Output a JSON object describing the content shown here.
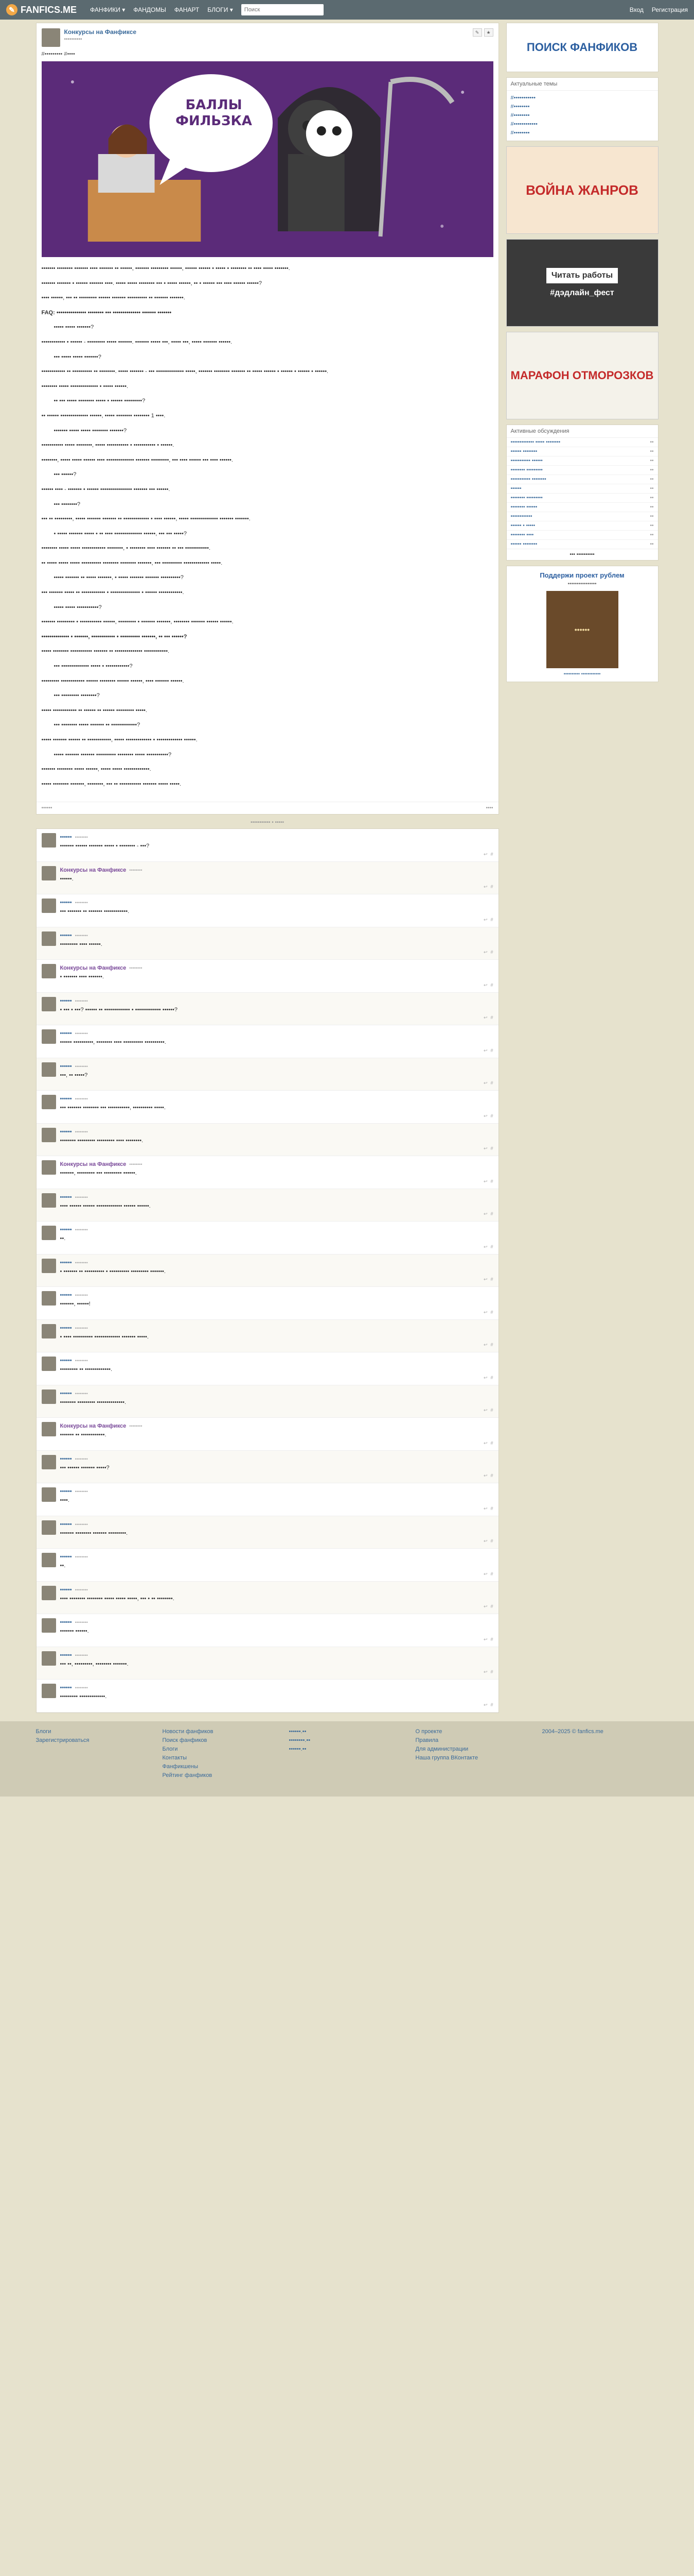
{
  "header": {
    "logo": "FANFICS.ME",
    "nav": [
      "ФАНФИКИ ▾",
      "ФАНДОМЫ",
      "ФАНАРТ",
      "БЛОГИ ▾"
    ],
    "search_placeholder": "Поиск",
    "login": "Вход",
    "register": "Регистрация"
  },
  "post": {
    "author": "Конкурсы на Фанфиксе",
    "date": "••••••••••",
    "tags": "#••••••••• #••••",
    "image_title": "БАЛЛЫ\nФИЛЬЗКА",
    "paragraphs": [
      {
        "t": "••••••• •••••••• ••••••• •••• ••••••• •• ••••••, ••••••• ••••••••• ••••••, •••••• •••••• • ••••• • •••••••• •• •••• ••••• •••••••.",
        "c": ""
      },
      {
        "t": "••••••• ••••••• • •••••• ••••••• ••••. ••••• ••••• •••••••• ••• • ••••• ••••••, •• • •••••• ••• •••• •••••• ••••••?",
        "c": ""
      },
      {
        "t": "•••• ••••••, ••• •• ••••••••• •••••• ••••••• •••••••••• •• ••••••• •••••••.",
        "c": ""
      },
      {
        "t": "FAQ: ••••••••••••••• •••••••• ••• •••••••••••••• ••••••• •••••••",
        "c": "b"
      },
      {
        "t": "••••• ••••• •••••••?",
        "c": "ind"
      },
      {
        "t": "•••••••••••• • •••••• - ••••••••• ••••• •••••••. ••••••• ••••• •••, ••••• •••, ••••• ••••••• ••••••.",
        "c": ""
      },
      {
        "t": "••• ••••• ••••• •••••••?",
        "c": "ind"
      },
      {
        "t": "•••••••••••• •• •••••••••• •• ••••••••. ••••• ••••••• - ••• •••••••••••••• •••••, ••••••• •••••••• ••••••• •• ••••• •••••• • •••••• • •••••• • ••••••.",
        "c": ""
      },
      {
        "t": "•••••••• ••••• •••••••••••••• • ••••• ••••••.",
        "c": ""
      },
      {
        "t": "•• ••• ••••• •••••••• ••••• • •••••• •••••••••?",
        "c": "ind"
      },
      {
        "t": "•• •••••• •••••••••••••• ••••••, ••••• •••••••• •••••••• 1 ••••.",
        "c": ""
      },
      {
        "t": "••••••• ••••• ••••• •••••••• •••••••?",
        "c": "ind"
      },
      {
        "t": "••••••••••• ••••• ••••••••, ••••• ••••••••••• • ••••••••••• • ••••••.",
        "c": ""
      },
      {
        "t": "••••••••, ••••• ••••• •••••• •••• •••••••••••••• ••••••• •••••••••, ••• •••• •••••• ••• •••• ••••••.",
        "c": ""
      },
      {
        "t": "••• ••••••?",
        "c": "ind"
      },
      {
        "t": "•••••• •••• - ••••••• • •••••• •••••••••••••••• ••••••• ••• ••••••.",
        "c": ""
      },
      {
        "t": "••• ••••••••?",
        "c": "ind"
      },
      {
        "t": "••• •• •••••••••, ••••• ••••••• ••••••• •• ••••••••••••• • •••• ••••••, ••••• •••••••••••••• ••••••• •••••••.",
        "c": ""
      },
      {
        "t": "• ••••• ••••••• ••••• • •• •••• •••••••••••••• ••••••, ••• ••• •••••?",
        "c": "ind"
      },
      {
        "t": "•••••••• ••••• ••••• •••••••••••• ••••••••, • •••••••• •••• ••••••• •• ••• ••••••••••••.",
        "c": ""
      },
      {
        "t": "•• ••••• ••••• ••••• •••••••••• •••••••• •••••••• •••••••, ••• •••••••••• ••••••••••••• •••••.",
        "c": ""
      },
      {
        "t": "••••• ••••••• •• ••••• •••••••, • ••••• ••••••• ••••••• ••••••••••?",
        "c": "ind"
      },
      {
        "t": "••• ••••••• ••••• •• •••••••••••• • ••••••••••••••• • •••••• ••••••••••••.",
        "c": ""
      },
      {
        "t": "••••• ••••• •••••••••••?",
        "c": "ind"
      },
      {
        "t": "••••••• ••••••••• • ••••••••••• ••••••, ••••••••• • ••••••• •••••••, •••••••• ••••••• •••••• ••••••.",
        "c": ""
      },
      {
        "t": "•••••••••••••• • •••••••, •••••••••••• • •••••••••• •••••••, •• ••• ••••••?",
        "c": "b"
      },
      {
        "t": "••••• •••••••• ••••••••••• ••••••• •• •••••••••••••• ••••••••••••.",
        "c": ""
      },
      {
        "t": "••• •••••••••••••• ••••• • ••••••••••••?",
        "c": "ind"
      },
      {
        "t": "••••••••• •••••••••••• •••••• •••••••• •••••• ••••••, •••• ••••••• ••••••.",
        "c": ""
      },
      {
        "t": "••• ••••••••• ••••••••?",
        "c": "ind"
      },
      {
        "t": "••••• •••••••••••• •• •••••• •• •••••• ••••••••• •••••.",
        "c": ""
      },
      {
        "t": "••• •••••••• ••••• ••••••• •• •••••••••••••?",
        "c": "ind"
      },
      {
        "t": "••••• ••••••• •••••• •• ••••••••••••, ••••• ••••••••••••• • ••••••••••••• ••••••.",
        "c": ""
      },
      {
        "t": "••••• ••••••• ••••••• •••••••••• •••••••• ••••• •••••••••••?",
        "c": "ind"
      },
      {
        "t": "••••••• •••••••• ••••• ••••••, ••••• ••••• •••••••••••••.",
        "c": ""
      },
      {
        "t": "••••• •••••••• •••••••, ••••••••, ••• •• ••••••••••• ••••••• ••••• •••••.",
        "c": ""
      }
    ],
    "footer_left": "••••••",
    "footer_right": "••••"
  },
  "comments_label": "••••••••••• • •••••",
  "comments": [
    {
      "author": "••••••",
      "date": "••••••••",
      "text": "••••••• •••••• ••••••• ••••• • •••••••• - •••?",
      "blog": false
    },
    {
      "author": "Конкурсы на Фанфиксе",
      "date": "••••••••",
      "text": "••••••.",
      "blog": true
    },
    {
      "author": "••••••",
      "date": "••••••••",
      "text": "••• ••••••• •• ••••••• ••••••••••••.",
      "blog": false
    },
    {
      "author": "••••••",
      "date": "••••••••",
      "text": "••••••••• •••• ••••••.",
      "blog": false
    },
    {
      "author": "Конкурсы на Фанфиксе",
      "date": "••••••••",
      "text": "• ••••••• •••• •••••••.",
      "blog": true
    },
    {
      "author": "••••••",
      "date": "••••••••",
      "text": "• ••• • •••? •••••• •• ••••••••••••• • ••••••••••••• ••••••?",
      "blog": false
    },
    {
      "author": "••••••",
      "date": "••••••••",
      "text": "•••••• ••••••••••, •••••••• •••• •••••••••• ••••••••••.",
      "blog": false
    },
    {
      "author": "••••••",
      "date": "••••••••",
      "text": "•••, •• •••••?",
      "blog": false
    },
    {
      "author": "••••••",
      "date": "••••••••",
      "text": "••• ••••••• •••••••• ••• •••••••••••, •••••••••• •••••.",
      "blog": false
    },
    {
      "author": "••••••",
      "date": "••••••••",
      "text": "•••••••• ••••••••• ••••••••• •••• ••••••••.",
      "blog": false
    },
    {
      "author": "Конкурсы на Фанфиксе",
      "date": "••••••••",
      "text": "•••••••, ••••••••• ••• ••••••••• ••••••.",
      "blog": true
    },
    {
      "author": "••••••",
      "date": "••••••••",
      "text": "•••• •••••• •••••• ••••••••••••• •••••• ••••••.",
      "blog": false
    },
    {
      "author": "••••••",
      "date": "••••••••",
      "text": "••.",
      "blog": false
    },
    {
      "author": "••••••",
      "date": "••••••••",
      "text": "• ••••••• •• •••••••••• • •••••••••• ••••••••• •••••••.",
      "blog": false
    },
    {
      "author": "••••••",
      "date": "••••••••",
      "text": "•••••••, ••••••!",
      "blog": false
    },
    {
      "author": "••••••",
      "date": "••••••••",
      "text": "• •••• •••••••••• ••••••••••••• ••••••• •••••.",
      "blog": false
    },
    {
      "author": "••••••",
      "date": "••••••••",
      "text": "••••••••• •• •••••••••••••.",
      "blog": false
    },
    {
      "author": "••••••",
      "date": "••••••••",
      "text": "•••••••• ••••••••• ••••••••••••••.",
      "blog": false
    },
    {
      "author": "Конкурсы на Фанфиксе",
      "date": "••••••••",
      "text": "••••••• •• ••••••••••••.",
      "blog": true
    },
    {
      "author": "••••••",
      "date": "••••••••",
      "text": "••• •••••• ••••••• •••••?",
      "blog": false
    },
    {
      "author": "••••••",
      "date": "••••••••",
      "text": "••••.",
      "blog": false
    },
    {
      "author": "••••••",
      "date": "••••••••",
      "text": "••••••• •••••••• ••••••• •••••••••.",
      "blog": false
    },
    {
      "author": "••••••",
      "date": "••••••••",
      "text": "••.",
      "blog": false
    },
    {
      "author": "••••••",
      "date": "••••••••",
      "text": "•••• •••••••• •••••••• ••••• ••••• •••••, ••• • •• ••••••••.",
      "blog": false
    },
    {
      "author": "••••••",
      "date": "••••••••",
      "text": "••••••• ••••••.",
      "blog": false
    },
    {
      "author": "••••••",
      "date": "••••••••",
      "text": "••• ••, •••••••••, •••••••• •••••••.",
      "blog": false
    },
    {
      "author": "••••••",
      "date": "••••••••",
      "text": "••••••••• •••••••••••••.",
      "blog": false
    }
  ],
  "sidebar": {
    "search_title": "ПОИСК ФАНФИКОВ",
    "actual_title": "Актуальные темы",
    "actual_items": [
      "#•••••••••••",
      "#••••••••",
      "#••••••••",
      "#••••••••••••",
      "#••••••••"
    ],
    "banner1": "ВОЙНА ЖАНРОВ",
    "banner2_a": "Читать работы",
    "banner2_b": "#дэдлайн_фест",
    "banner3": "МАРАФОН ОТМОРОЗКОВ",
    "discuss_title": "Активные обсуждения",
    "discuss": [
      {
        "t": "••••••••••••• ••••• ••••••••",
        "n": "••"
      },
      {
        "t": "•••••• ••••••••",
        "n": "••"
      },
      {
        "t": "••••••••••• ••••••",
        "n": "••"
      },
      {
        "t": "•••••••• •••••••••",
        "n": "••"
      },
      {
        "t": "••••••••••• ••••••••",
        "n": "••"
      },
      {
        "t": "••••••",
        "n": "••"
      },
      {
        "t": "•••••••• •••••••••",
        "n": "••"
      },
      {
        "t": "•••••••• ••••••",
        "n": "••"
      },
      {
        "t": "••••••••••••",
        "n": "••"
      },
      {
        "t": "•••••• • •••••",
        "n": "••"
      },
      {
        "t": "•••••••• ••••",
        "n": "••"
      },
      {
        "t": "•••••• ••••••••",
        "n": "••"
      }
    ],
    "discuss_more": "••• ••••••••••",
    "support_title": "Поддержи проект рублем",
    "support_sub": "••••••••••••••••",
    "donate_label": "••••••",
    "donate_caption": "•••••••••• ••••••••••••"
  },
  "footer": {
    "cols": [
      [
        "Блоги",
        "Зарегистрироваться"
      ],
      [
        "Новости фанфиков",
        "Поиск фанфиков",
        "Блоги",
        "Контакты",
        "Фанфикшены",
        "Рейтинг фанфиков"
      ],
      [
        "••••••.••",
        "••••••••.••",
        "••••••.••"
      ],
      [
        "О проекте",
        "Правила",
        "Для администрации",
        "Наша группа ВКонтакте"
      ],
      [
        "2004–2025 © fanfics.me"
      ]
    ]
  },
  "colors": {
    "brand": "#5b6a70",
    "bg": "#e6e2cd",
    "link": "#3a6a9a",
    "post_img": "#5b2b79"
  }
}
